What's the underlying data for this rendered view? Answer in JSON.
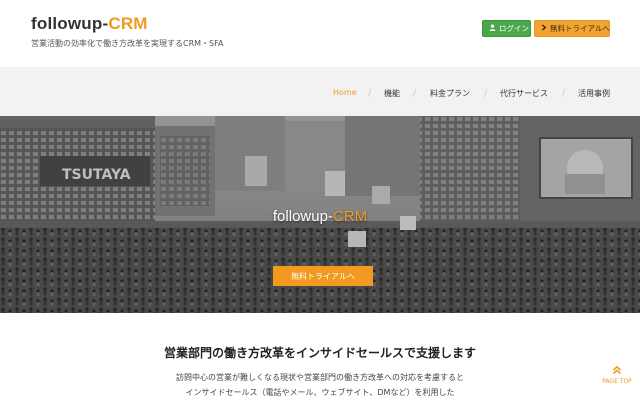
{
  "header": {
    "logo_prefix": "followup-",
    "logo_accent": "CRM",
    "tagline": "営業活動の効率化で働き方改革を実現するCRM・SFA",
    "login_label": "ログイン",
    "trial_label": "無料トライアルへ"
  },
  "nav": {
    "items": [
      {
        "label": "Home"
      },
      {
        "label": "機能"
      },
      {
        "label": "料金プラン"
      },
      {
        "label": "代行サービス"
      },
      {
        "label": "活用事例"
      }
    ]
  },
  "hero": {
    "title_prefix": "followup-",
    "title_accent": "CRM",
    "button_label": "無料トライアルへ",
    "sign_text": "TSUTAYA"
  },
  "section": {
    "title": "営業部門の働き方改革をインサイドセールスで支援します",
    "line1": "訪問中心の営業が難しくなる現状や営業部門の働き方改革への対応を考慮すると",
    "line2": "インサイドセールス（電話やメール、ウェブサイト、DMなど）を利用した"
  },
  "page_top": {
    "label": "PAGE TOP"
  },
  "colors": {
    "accent": "#f29a1f",
    "login_green": "#4aa84a",
    "nav_bg": "#f2f2f2"
  },
  "icons": {
    "login": "user-icon",
    "trial": "chevron-right-icon",
    "page_top": "double-chevron-up-icon"
  }
}
